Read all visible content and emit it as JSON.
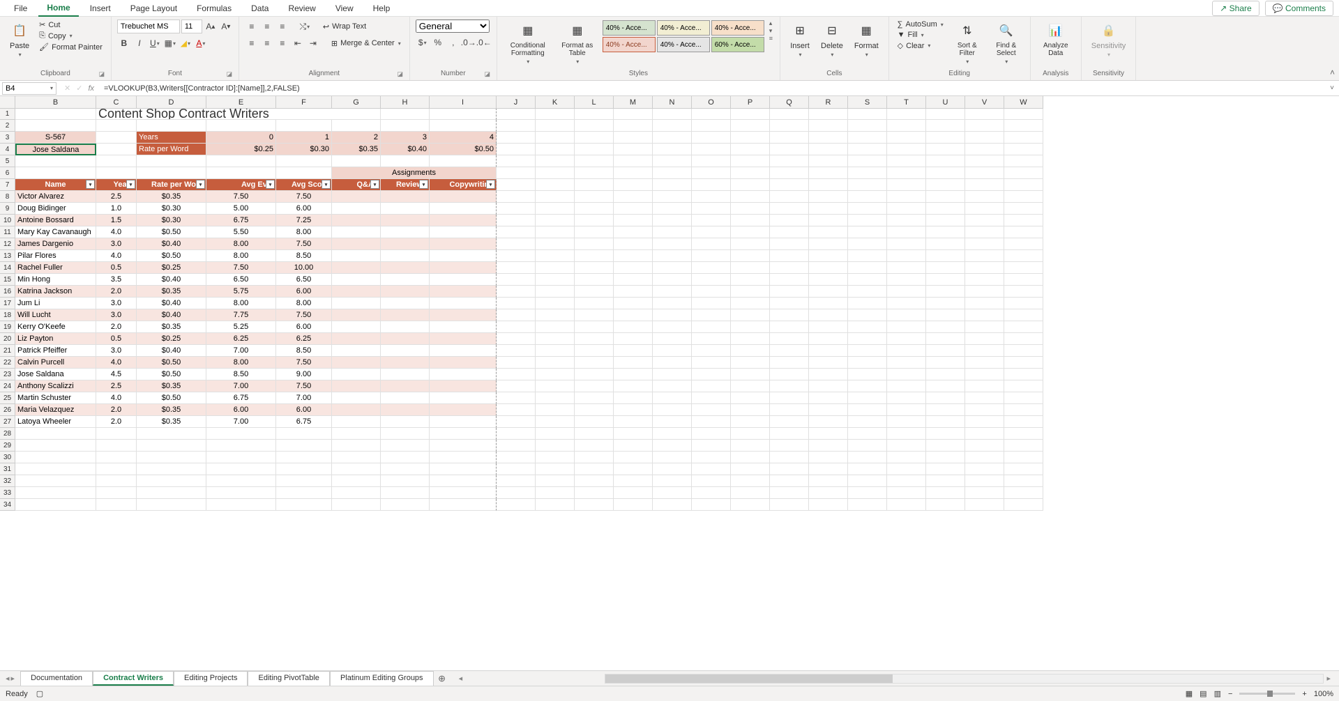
{
  "tabs": [
    "File",
    "Home",
    "Insert",
    "Page Layout",
    "Formulas",
    "Data",
    "Review",
    "View",
    "Help"
  ],
  "active_tab": "Home",
  "share_label": "Share",
  "comments_label": "Comments",
  "ribbon": {
    "clipboard": {
      "paste": "Paste",
      "cut": "Cut",
      "copy": "Copy",
      "format_painter": "Format Painter",
      "label": "Clipboard"
    },
    "font": {
      "name": "Trebuchet MS",
      "size": "11",
      "label": "Font"
    },
    "alignment": {
      "wrap": "Wrap Text",
      "merge": "Merge & Center",
      "label": "Alignment"
    },
    "number": {
      "format": "General",
      "label": "Number"
    },
    "styles": {
      "conditional": "Conditional Formatting",
      "format_table": "Format as Table",
      "swatches_row1": [
        "40% - Acce...",
        "40% - Acce...",
        "40% - Acce..."
      ],
      "swatches_row2": [
        "40% - Acce...",
        "40% - Acce...",
        "60% - Acce..."
      ],
      "label": "Styles"
    },
    "cells": {
      "insert": "Insert",
      "delete": "Delete",
      "format": "Format",
      "label": "Cells"
    },
    "editing": {
      "autosum": "AutoSum",
      "fill": "Fill",
      "clear": "Clear",
      "sort": "Sort & Filter",
      "find": "Find & Select",
      "label": "Editing"
    },
    "analysis": {
      "analyze": "Analyze Data",
      "label": "Analysis"
    },
    "sensitivity": {
      "sensitivity": "Sensitivity",
      "label": "Sensitivity"
    }
  },
  "name_box": "B4",
  "formula": "=VLOOKUP(B3,Writers[[Contractor ID]:[Name]],2,FALSE)",
  "columns": [
    "B",
    "C",
    "D",
    "E",
    "F",
    "G",
    "H",
    "I",
    "J",
    "K",
    "L",
    "M",
    "N",
    "O",
    "P",
    "Q",
    "R",
    "S",
    "T",
    "U",
    "V",
    "W"
  ],
  "sheet": {
    "title": "Content Shop Contract Writers",
    "lookup_id": "S-567",
    "lookup_name": "Jose Saldana",
    "years_label": "Years",
    "rate_label": "Rate per Word",
    "year_heads": [
      "0",
      "1",
      "2",
      "3",
      "4"
    ],
    "rate_row": [
      "$0.25",
      "$0.30",
      "$0.35",
      "$0.40",
      "$0.50"
    ],
    "assignments_label": "Assignments",
    "headers": [
      "Name",
      "Years",
      "Rate per Word",
      "Avg Eval",
      "Avg Score",
      "Q&As",
      "Reviews",
      "Copywriting"
    ],
    "rows": [
      {
        "name": "Victor Alvarez",
        "years": "2.5",
        "rate": "$0.35",
        "eval": "7.50",
        "score": "7.50"
      },
      {
        "name": "Doug Bidinger",
        "years": "1.0",
        "rate": "$0.30",
        "eval": "5.00",
        "score": "6.00"
      },
      {
        "name": "Antoine Bossard",
        "years": "1.5",
        "rate": "$0.30",
        "eval": "6.75",
        "score": "7.25"
      },
      {
        "name": "Mary Kay Cavanaugh",
        "years": "4.0",
        "rate": "$0.50",
        "eval": "5.50",
        "score": "8.00"
      },
      {
        "name": "James Dargenio",
        "years": "3.0",
        "rate": "$0.40",
        "eval": "8.00",
        "score": "7.50"
      },
      {
        "name": "Pilar Flores",
        "years": "4.0",
        "rate": "$0.50",
        "eval": "8.00",
        "score": "8.50"
      },
      {
        "name": "Rachel Fuller",
        "years": "0.5",
        "rate": "$0.25",
        "eval": "7.50",
        "score": "10.00"
      },
      {
        "name": "Min Hong",
        "years": "3.5",
        "rate": "$0.40",
        "eval": "6.50",
        "score": "6.50"
      },
      {
        "name": "Katrina Jackson",
        "years": "2.0",
        "rate": "$0.35",
        "eval": "5.75",
        "score": "6.00"
      },
      {
        "name": "Jum Li",
        "years": "3.0",
        "rate": "$0.40",
        "eval": "8.00",
        "score": "8.00"
      },
      {
        "name": "Will Lucht",
        "years": "3.0",
        "rate": "$0.40",
        "eval": "7.75",
        "score": "7.50"
      },
      {
        "name": "Kerry O'Keefe",
        "years": "2.0",
        "rate": "$0.35",
        "eval": "5.25",
        "score": "6.00"
      },
      {
        "name": "Liz Payton",
        "years": "0.5",
        "rate": "$0.25",
        "eval": "6.25",
        "score": "6.25"
      },
      {
        "name": "Patrick Pfeiffer",
        "years": "3.0",
        "rate": "$0.40",
        "eval": "7.00",
        "score": "8.50"
      },
      {
        "name": "Calvin Purcell",
        "years": "4.0",
        "rate": "$0.50",
        "eval": "8.00",
        "score": "7.50"
      },
      {
        "name": "Jose Saldana",
        "years": "4.5",
        "rate": "$0.50",
        "eval": "8.50",
        "score": "9.00"
      },
      {
        "name": "Anthony Scalizzi",
        "years": "2.5",
        "rate": "$0.35",
        "eval": "7.00",
        "score": "7.50"
      },
      {
        "name": "Martin Schuster",
        "years": "4.0",
        "rate": "$0.50",
        "eval": "6.75",
        "score": "7.00"
      },
      {
        "name": "Maria Velazquez",
        "years": "2.0",
        "rate": "$0.35",
        "eval": "6.00",
        "score": "6.00"
      },
      {
        "name": "Latoya Wheeler",
        "years": "2.0",
        "rate": "$0.35",
        "eval": "7.00",
        "score": "6.75"
      }
    ]
  },
  "sheet_tabs": [
    "Documentation",
    "Contract Writers",
    "Editing Projects",
    "Editing PivotTable",
    "Platinum Editing Groups"
  ],
  "active_sheet": "Contract Writers",
  "status": {
    "ready": "Ready",
    "zoom": "100%"
  }
}
